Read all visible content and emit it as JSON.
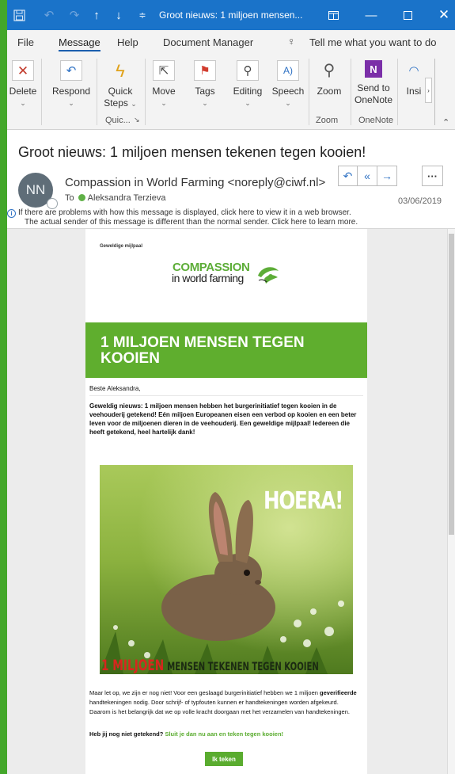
{
  "window": {
    "title": "Groot nieuws: 1 miljoen mensen...",
    "icons": [
      "save-icon",
      "undo-icon",
      "redo-icon",
      "up-arrow-icon",
      "down-arrow-icon",
      "customize-icon",
      "restore-icon",
      "minimize-icon",
      "maximize-icon",
      "close-icon"
    ]
  },
  "menu": {
    "items": [
      "File",
      "Message",
      "Help",
      "Document Manager"
    ],
    "active": "Message",
    "tell_me": "Tell me what you want to do"
  },
  "ribbon": {
    "delete": "Delete",
    "respond": "Respond",
    "quick_steps_1": "Quick",
    "quick_steps_2": "Steps",
    "quick_group": "Quic...",
    "move": "Move",
    "tags": "Tags",
    "editing": "Editing",
    "speech": "Speech",
    "zoom": "Zoom",
    "zoom_group": "Zoom",
    "send_to": "Send to",
    "onenote": "OneNote",
    "onenote_group": "OneNote",
    "insights": "Insi"
  },
  "message": {
    "subject": "Groot nieuws: 1 miljoen mensen tekenen tegen kooien!",
    "avatar_initials": "NN",
    "sender": "Compassion in World Farming <noreply@ciwf.nl>",
    "to_label": "To",
    "recipient": "Aleksandra Terzieva",
    "date": "03/06/2019",
    "info_line1": "If there are problems with how this message is displayed, click here to view it in a web browser.",
    "info_line2": "The actual sender of this message is different than the normal sender. Click here to learn more."
  },
  "email": {
    "preheader": "Geweldige mijlpaal",
    "logo_line1": "COMPASSION",
    "logo_line2": "in world farming",
    "headline": "1 MILJOEN MENSEN TEGEN KOOIEN",
    "greeting": "Beste Aleksandra,",
    "intro": "Geweldig nieuws: 1 miljoen mensen hebben het burgerinitiatief tegen kooien in de veehouderij getekend! Eén miljoen Europeanen eisen een verbod op kooien en een beter leven voor de miljoenen dieren in de veehouderij. Een geweldige mijlpaal! Iedereen die heeft getekend, heel hartelijk dank!",
    "image_hoera": "HOERA!",
    "image_caption_red": "1 MILJOEN",
    "image_caption_rest": "MENSEN TEKENEN TEGEN KOOIEN",
    "para2_a": "Maar let op, we zijn er nog niet! Voor een geslaagd burgerinitiatief hebben we 1 miljoen",
    "para2_bold": "geverifieerde",
    "para2_b": "handtekeningen nodig. Door schrijf- of typfouten kunnen er handtekeningen worden afgekeurd. Daarom is het belangrijk dat we op volle kracht doorgaan met het verzamelen van handtekeningen.",
    "cta_question": "Heb jij nog niet getekend?",
    "cta_link": "Sluit je dan nu aan en teken tegen kooien!",
    "button": "Ik teken"
  },
  "colors": {
    "titlebar": "#1a73c9",
    "brand_green": "#5fae2e",
    "desktop": "#43a72a"
  }
}
